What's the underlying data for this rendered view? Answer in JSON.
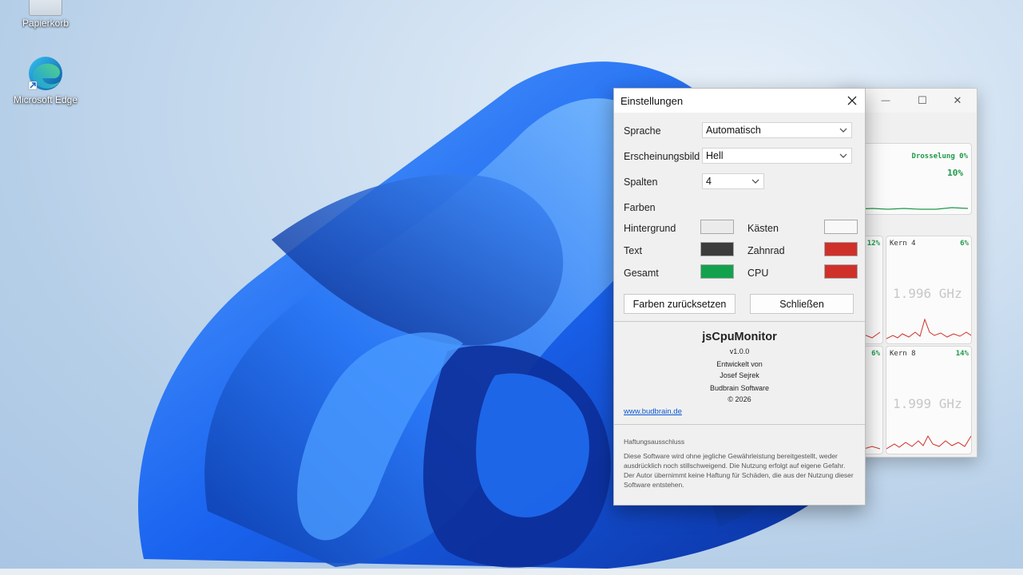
{
  "desktop": {
    "icons": [
      {
        "label": "Papierkorb",
        "icon": "recycle-bin-icon"
      },
      {
        "label": "Microsoft Edge",
        "icon": "edge-browser-icon"
      }
    ]
  },
  "monitor": {
    "window_controls": {
      "minimize": "—",
      "maximize": "☐",
      "close": "✕"
    },
    "total": {
      "throttle_label": "Drosselung 0%",
      "percent": "10%"
    },
    "cores": [
      {
        "label": "",
        "percent": "12%",
        "ghz": "Hz"
      },
      {
        "label": "Kern 4",
        "percent": "6%",
        "ghz": "1.996 GHz"
      },
      {
        "label": "",
        "percent": "6%",
        "ghz": "z"
      },
      {
        "label": "Kern 8",
        "percent": "14%",
        "ghz": "1.999 GHz"
      }
    ]
  },
  "settings": {
    "title": "Einstellungen",
    "language": {
      "label": "Sprache",
      "value": "Automatisch"
    },
    "appearance": {
      "label": "Erscheinungsbild",
      "value": "Hell"
    },
    "columns": {
      "label": "Spalten",
      "value": "4"
    },
    "colors": {
      "heading": "Farben",
      "items": [
        {
          "label": "Hintergrund",
          "color": "#ebebeb"
        },
        {
          "label": "Kästen",
          "color": "#f8f8f8"
        },
        {
          "label": "Text",
          "color": "#3c3c3c"
        },
        {
          "label": "Zahnrad",
          "color": "#d0302a"
        },
        {
          "label": "Gesamt",
          "color": "#12a24e"
        },
        {
          "label": "CPU",
          "color": "#d0302a"
        }
      ]
    },
    "buttons": {
      "reset": "Farben zurücksetzen",
      "close": "Schließen"
    },
    "about": {
      "app_name": "jsCpuMonitor",
      "version": "v1.0.0",
      "developed_by": "Entwickelt von",
      "author": "Josef Sejrek",
      "company": "Budbrain Software",
      "copyright": "© 2026",
      "website": "www.budbrain.de"
    },
    "disclaimer": {
      "title": "Haftungsausschluss",
      "text": "Diese Software wird ohne jegliche Gewährleistung bereitgestellt, weder ausdrücklich noch stillschweigend. Die Nutzung erfolgt auf eigene Gefahr. Der Autor übernimmt keine Haftung für Schäden, die aus der Nutzung dieser Software entstehen."
    }
  }
}
